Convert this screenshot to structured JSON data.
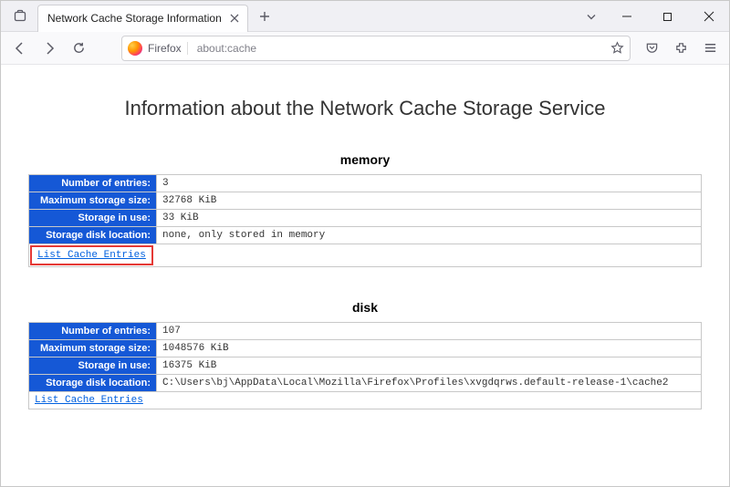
{
  "window": {
    "tab_title": "Network Cache Storage Information"
  },
  "addressbar": {
    "identity": "Firefox",
    "url": "about:cache"
  },
  "page": {
    "title": "Information about the Network Cache Storage Service",
    "memory": {
      "heading": "memory",
      "labels": {
        "entries": "Number of entries:",
        "max": "Maximum storage size:",
        "inuse": "Storage in use:",
        "disk": "Storage disk location:"
      },
      "values": {
        "entries": "3",
        "max": "32768 KiB",
        "inuse": "33 KiB",
        "disk": "none, only stored in memory"
      },
      "link": "List Cache Entries"
    },
    "disk": {
      "heading": "disk",
      "labels": {
        "entries": "Number of entries:",
        "max": "Maximum storage size:",
        "inuse": "Storage in use:",
        "disk": "Storage disk location:"
      },
      "values": {
        "entries": "107",
        "max": "1048576 KiB",
        "inuse": "16375 KiB",
        "disk": "C:\\Users\\bj\\AppData\\Local\\Mozilla\\Firefox\\Profiles\\xvgdqrws.default-release-1\\cache2"
      },
      "link": "List Cache Entries"
    }
  }
}
